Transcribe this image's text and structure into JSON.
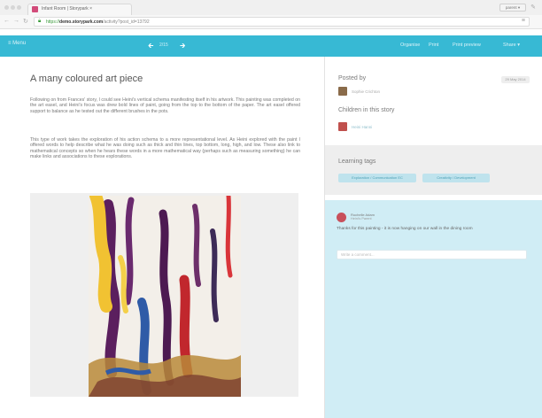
{
  "browser": {
    "tab_title": "Infant Room | Storypark ×",
    "tab_close": "×",
    "user_chip": "parent ▾",
    "url_proto": "https://",
    "url_host": "demo.storypark.com",
    "url_path": "/activity?post_id=13792"
  },
  "navbar": {
    "menu_label": "≡ Menu",
    "prev_icon": "arrow-left-icon",
    "next_icon": "arrow-right-icon",
    "story_counter": "2/15",
    "links": [
      "Organise",
      "Print",
      "Print preview",
      "Share ▾"
    ]
  },
  "story": {
    "title": "A many coloured art piece",
    "paragraph_1": "Following on from Frances' story, I could see Heini's vertical schema manifesting itself in his artwork. This painting was completed on the art easel, and Heini's focus was drew bold lines of paint, going from the top to the bottom of the paper. The art easel offered support to balance as he tested out the different brushes in the pots.",
    "paragraph_2": "This type of work takes the exploration of his action schema to a more representational level. As Heini explored with the paint I offered words to help describe what he was doing such as thick and thin lines, top bottom, long, high, and low. These also link to mathematical concepts so when he hears these words in a more mathematical way (perhaps such as measuring something) he can make links and associations to these explorations.",
    "photo_icon": "artwork-photo"
  },
  "sidebar": {
    "posted_by_label": "Posted by",
    "posted_by_name": "Sophie Crichton",
    "date": "29 May 2014",
    "children_label": "Children in this story",
    "child_name": "Heini Hanni",
    "learning_tags_label": "Learning tags",
    "tags": [
      "Exploration / Communication EC",
      "Creativity / Development"
    ]
  },
  "comments": {
    "author": "Rochelle Adam",
    "role": "Heini's Parent",
    "text": "Thanks for this painting - it is now hanging on our wall in the dining room",
    "input_placeholder": "Write a comment..."
  }
}
